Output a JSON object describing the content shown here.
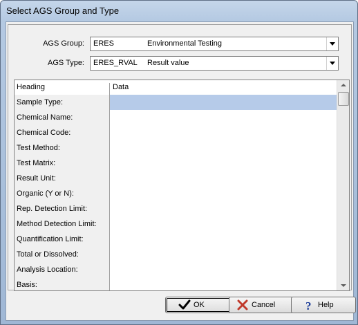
{
  "window": {
    "title": "Select AGS Group and Type"
  },
  "ags_group": {
    "label": "AGS Group:",
    "code": "ERES",
    "description": "Environmental Testing"
  },
  "ags_type": {
    "label": "AGS Type:",
    "code": "ERES_RVAL",
    "description": "Result value"
  },
  "grid": {
    "headers": [
      "Heading",
      "Data"
    ],
    "rows": [
      {
        "heading": "Sample Type:",
        "data": ""
      },
      {
        "heading": "Chemical Name:",
        "data": ""
      },
      {
        "heading": "Chemical Code:",
        "data": ""
      },
      {
        "heading": "Test Method:",
        "data": ""
      },
      {
        "heading": "Test Matrix:",
        "data": ""
      },
      {
        "heading": "Result Unit:",
        "data": ""
      },
      {
        "heading": "Organic (Y or N):",
        "data": ""
      },
      {
        "heading": "Rep. Detection Limit:",
        "data": ""
      },
      {
        "heading": "Method Detection Limit:",
        "data": ""
      },
      {
        "heading": "Quantification Limit:",
        "data": ""
      },
      {
        "heading": "Total or Dissolved:",
        "data": ""
      },
      {
        "heading": "Analysis Location:",
        "data": ""
      },
      {
        "heading": "Basis:",
        "data": ""
      }
    ],
    "selected_row": 0
  },
  "buttons": {
    "ok": {
      "label": "OK",
      "icon": "checkmark-icon"
    },
    "cancel": {
      "label": "Cancel",
      "icon": "x-icon",
      "icon_color": "#c0392b"
    },
    "help": {
      "label": "Help",
      "icon": "question-icon",
      "icon_color": "#1f3f9a"
    }
  }
}
